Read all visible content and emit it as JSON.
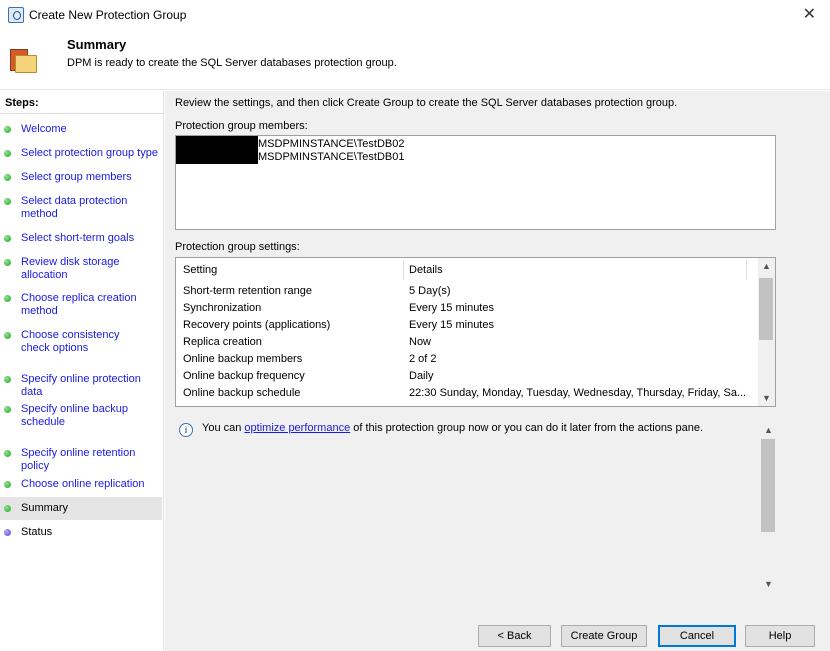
{
  "window": {
    "title": "Create New Protection Group",
    "close_glyph": "✕"
  },
  "header": {
    "title": "Summary",
    "description": "DPM is ready to create the SQL Server databases protection group.",
    "icon": "protection-group-folder-icon"
  },
  "steps": {
    "title": "Steps:",
    "items": [
      {
        "label": "Welcome",
        "status": "complete"
      },
      {
        "label": "Select protection group type",
        "status": "complete"
      },
      {
        "label": "Select group members",
        "status": "complete"
      },
      {
        "label": "Select data protection method",
        "status": "complete"
      },
      {
        "label": "Select short-term goals",
        "status": "complete"
      },
      {
        "label": "Review disk storage allocation",
        "status": "complete"
      },
      {
        "label": "Choose replica creation method",
        "status": "complete"
      },
      {
        "label": "Choose consistency check options",
        "status": "complete"
      },
      {
        "label": "Specify online protection data",
        "status": "complete"
      },
      {
        "label": "Specify online backup schedule",
        "status": "complete"
      },
      {
        "label": "Specify online retention policy",
        "status": "complete"
      },
      {
        "label": "Choose online replication",
        "status": "complete"
      },
      {
        "label": "Summary",
        "status": "current"
      },
      {
        "label": "Status",
        "status": "pending"
      }
    ],
    "colors": {
      "complete": "#21a221",
      "pending": "#5a3fd6",
      "link": "#1a1ae0"
    }
  },
  "main": {
    "review_text": "Review the settings, and then click Create Group to create the SQL Server databases protection group.",
    "members_label": "Protection group members:",
    "members": [
      "MSDPMINSTANCE\\TestDB02",
      "MSDPMINSTANCE\\TestDB01"
    ],
    "settings_label": "Protection group settings:",
    "settings_columns": [
      "Setting",
      "Details"
    ],
    "settings_rows": [
      {
        "setting": "Short-term retention range",
        "details": "5 Day(s)"
      },
      {
        "setting": "Synchronization",
        "details": "Every 15 minutes"
      },
      {
        "setting": "Recovery points (applications)",
        "details": "Every 15 minutes"
      },
      {
        "setting": "Replica creation",
        "details": "Now"
      },
      {
        "setting": "Online backup members",
        "details": "2 of 2"
      },
      {
        "setting": "Online backup frequency",
        "details": "Daily"
      },
      {
        "setting": "Online backup schedule",
        "details": "22:30 Sunday, Monday, Tuesday, Wednesday, Thursday, Friday, Sa..."
      }
    ],
    "info": {
      "prefix": "You can ",
      "link": "optimize performance",
      "suffix": " of this protection group now or you can do it later from the actions pane."
    }
  },
  "buttons": {
    "back": "< Back",
    "create": "Create Group",
    "cancel": "Cancel",
    "help": "Help"
  }
}
